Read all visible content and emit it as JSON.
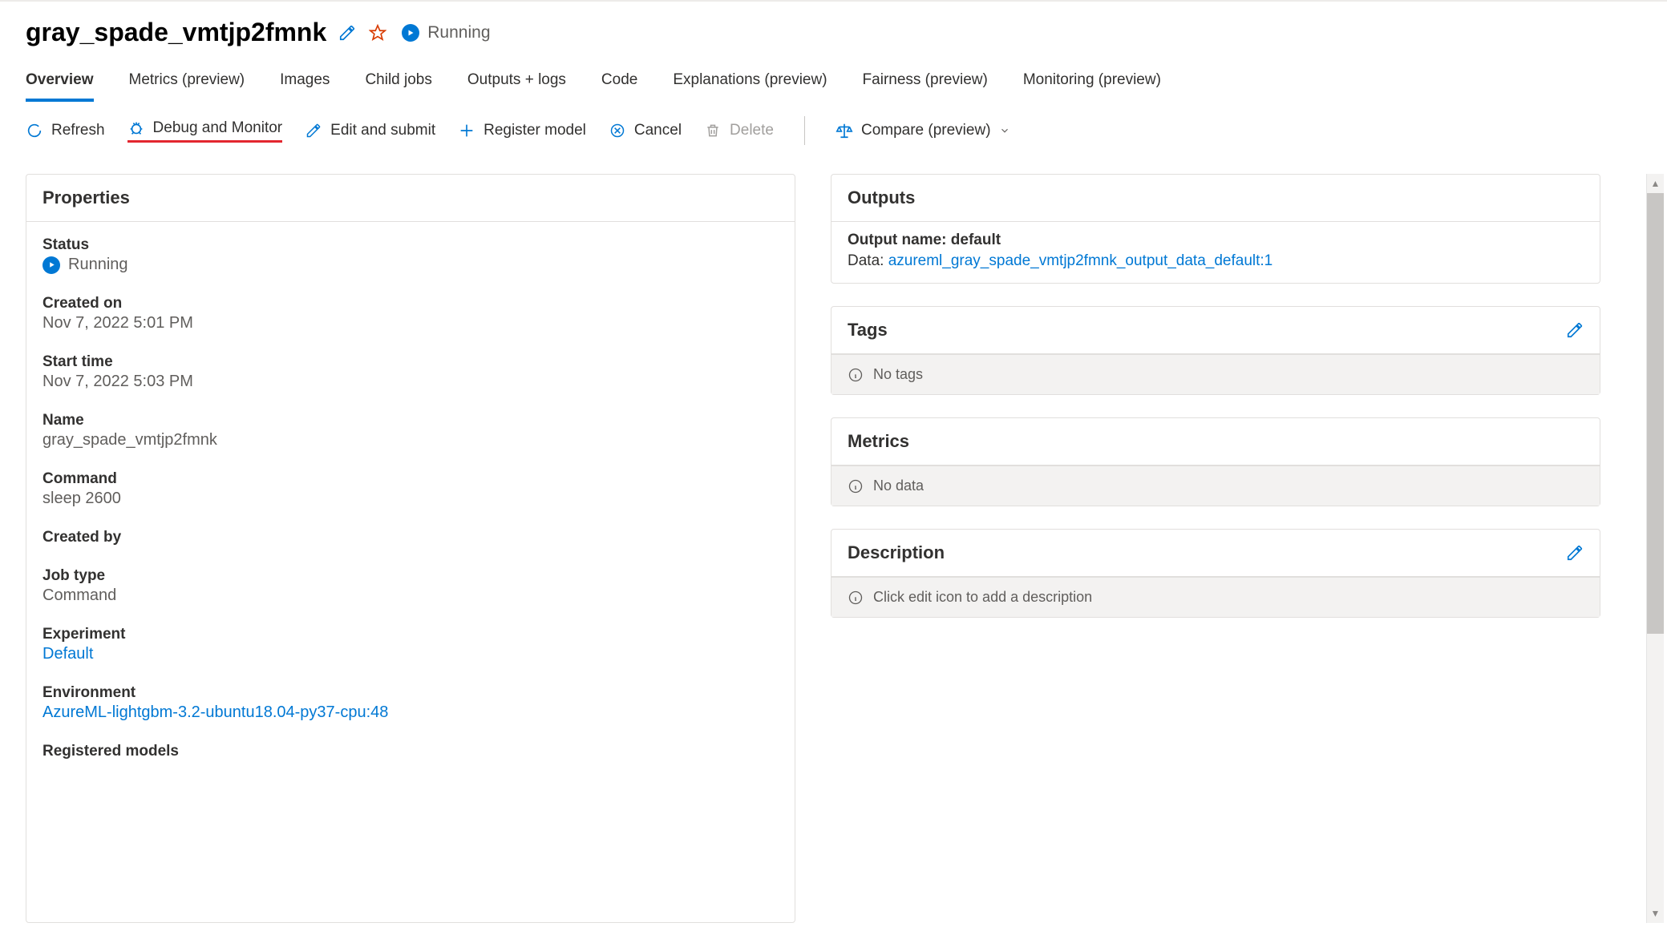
{
  "header": {
    "title": "gray_spade_vmtjp2fmnk",
    "status": "Running"
  },
  "tabs": [
    {
      "label": "Overview",
      "active": true
    },
    {
      "label": "Metrics (preview)"
    },
    {
      "label": "Images"
    },
    {
      "label": "Child jobs"
    },
    {
      "label": "Outputs + logs"
    },
    {
      "label": "Code"
    },
    {
      "label": "Explanations (preview)"
    },
    {
      "label": "Fairness (preview)"
    },
    {
      "label": "Monitoring (preview)"
    }
  ],
  "toolbar": {
    "refresh": "Refresh",
    "debug": "Debug and Monitor",
    "edit": "Edit and submit",
    "register": "Register model",
    "cancel": "Cancel",
    "delete": "Delete",
    "compare": "Compare (preview)"
  },
  "properties": {
    "title": "Properties",
    "items": {
      "status_label": "Status",
      "status_value": "Running",
      "created_on_label": "Created on",
      "created_on_value": "Nov 7, 2022 5:01 PM",
      "start_time_label": "Start time",
      "start_time_value": "Nov 7, 2022 5:03 PM",
      "name_label": "Name",
      "name_value": "gray_spade_vmtjp2fmnk",
      "command_label": "Command",
      "command_value": "sleep 2600",
      "created_by_label": "Created by",
      "created_by_value": "",
      "job_type_label": "Job type",
      "job_type_value": "Command",
      "experiment_label": "Experiment",
      "experiment_value": "Default",
      "environment_label": "Environment",
      "environment_value": "AzureML-lightgbm-3.2-ubuntu18.04-py37-cpu:48",
      "registered_models_label": "Registered models"
    }
  },
  "outputs": {
    "title": "Outputs",
    "name_label": "Output name: default",
    "data_label": "Data: ",
    "data_link": "azureml_gray_spade_vmtjp2fmnk_output_data_default:1"
  },
  "tags": {
    "title": "Tags",
    "empty": "No tags"
  },
  "metrics": {
    "title": "Metrics",
    "empty": "No data"
  },
  "description": {
    "title": "Description",
    "empty": "Click edit icon to add a description"
  }
}
